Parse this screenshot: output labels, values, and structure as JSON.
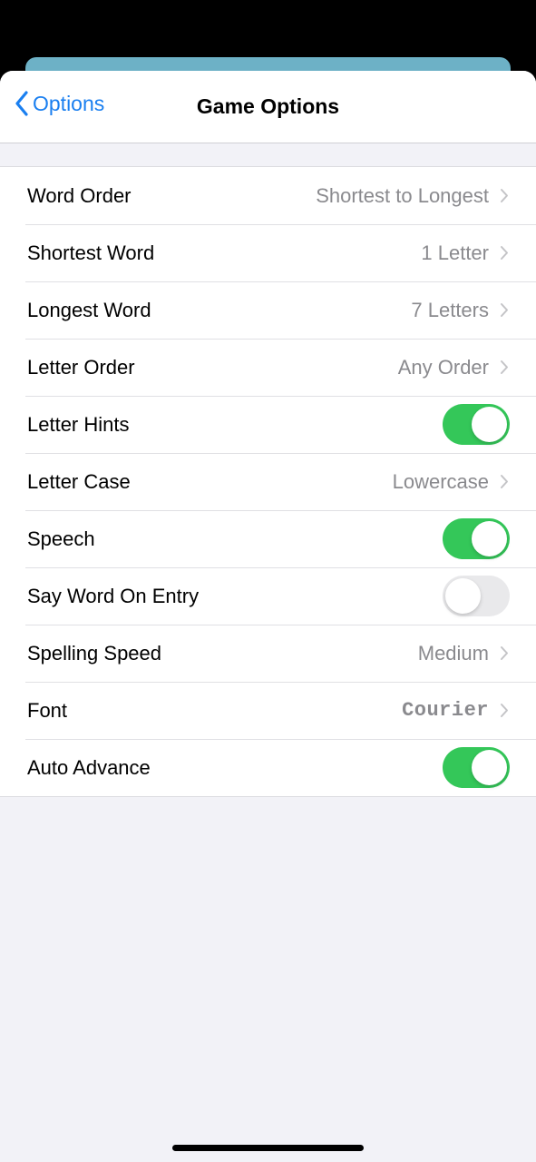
{
  "navbar": {
    "back_label": "Options",
    "title": "Game Options"
  },
  "colors": {
    "accent": "#1a7ff0",
    "toggle_on": "#34c759",
    "toggle_off": "#e9e9eb",
    "value_text": "#8a8a8e",
    "background": "#f2f2f7"
  },
  "settings": [
    {
      "label": "Word Order",
      "type": "disclosure",
      "value": "Shortest to Longest"
    },
    {
      "label": "Shortest Word",
      "type": "disclosure",
      "value": "1 Letter"
    },
    {
      "label": "Longest Word",
      "type": "disclosure",
      "value": "7 Letters"
    },
    {
      "label": "Letter Order",
      "type": "disclosure",
      "value": "Any Order"
    },
    {
      "label": "Letter Hints",
      "type": "toggle",
      "on": true
    },
    {
      "label": "Letter Case",
      "type": "disclosure",
      "value": "Lowercase"
    },
    {
      "label": "Speech",
      "type": "toggle",
      "on": true
    },
    {
      "label": "Say Word On Entry",
      "type": "toggle",
      "on": false
    },
    {
      "label": "Spelling Speed",
      "type": "disclosure",
      "value": "Medium"
    },
    {
      "label": "Font",
      "type": "disclosure",
      "value": "Courier"
    },
    {
      "label": "Auto Advance",
      "type": "toggle",
      "on": true
    }
  ]
}
